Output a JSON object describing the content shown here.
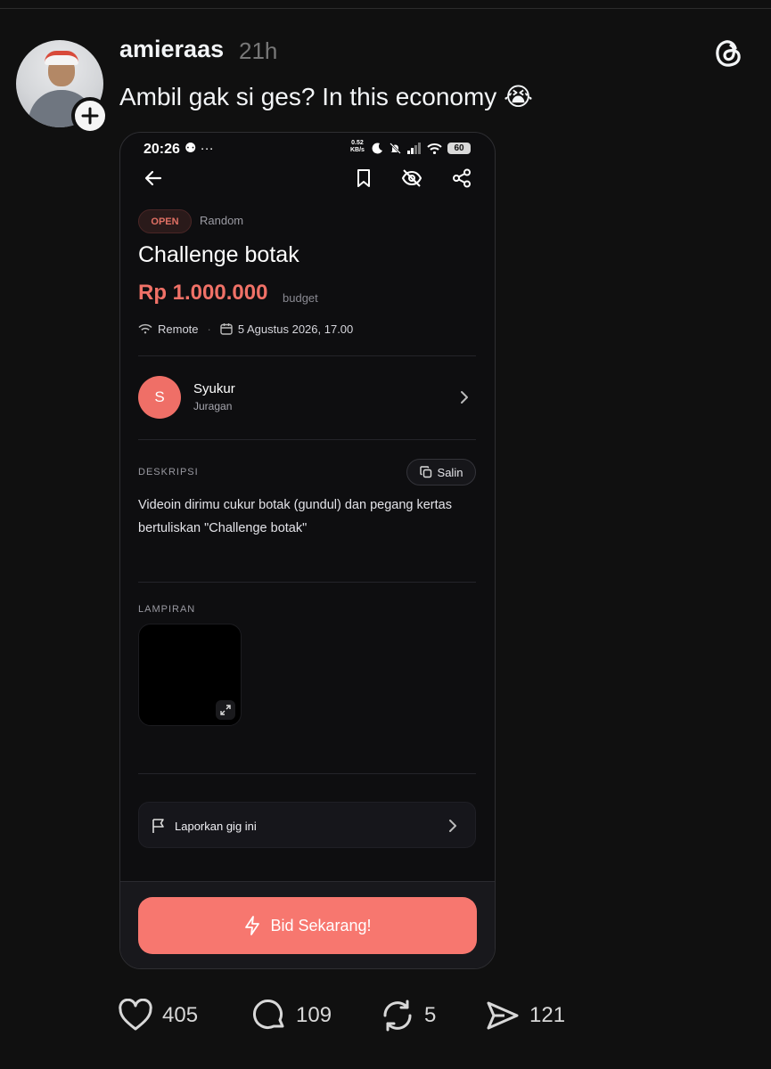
{
  "post": {
    "username": "amieraas",
    "time": "21h",
    "caption": "Ambil gak si ges? In this economy 😭",
    "follow_icon": "plus-icon",
    "app_logo": "threads-logo"
  },
  "phone": {
    "status_bar": {
      "time": "20:26",
      "extra": "⚉ ···",
      "speed_value": "0.52",
      "speed_unit": "KB/s",
      "battery": "60"
    },
    "gig": {
      "status_badge": "OPEN",
      "category": "Random",
      "title": "Challenge botak",
      "price": "Rp 1.000.000",
      "price_suffix": "budget",
      "location": "Remote",
      "separator": "·",
      "deadline": "5 Agustus 2026, 17.00"
    },
    "owner": {
      "initial": "S",
      "name": "Syukur",
      "role": "Juragan"
    },
    "description": {
      "label": "DESKRIPSI",
      "copy_label": "Salin",
      "text": "Videoin dirimu cukur botak (gundul) dan pegang kertas bertuliskan \"Challenge botak\""
    },
    "attachments": {
      "label": "LAMPIRAN"
    },
    "report": {
      "label": "Laporkan gig ini"
    },
    "bid_button": {
      "label": "Bid Sekarang!"
    },
    "colors": {
      "accent": "#f7776f",
      "price": "#f07167",
      "background": "#0e0e10"
    }
  },
  "actions": {
    "likes": "405",
    "comments": "109",
    "reposts": "5",
    "shares": "121"
  }
}
